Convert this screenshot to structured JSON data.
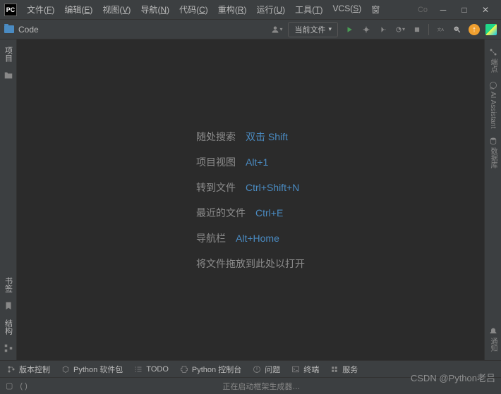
{
  "titlebar": {
    "logo": "PC",
    "menus": [
      {
        "label": "文件",
        "key": "F"
      },
      {
        "label": "编辑",
        "key": "E"
      },
      {
        "label": "视图",
        "key": "V"
      },
      {
        "label": "导航",
        "key": "N"
      },
      {
        "label": "代码",
        "key": "C"
      },
      {
        "label": "重构",
        "key": "R"
      },
      {
        "label": "运行",
        "key": "U"
      },
      {
        "label": "工具",
        "key": "T"
      },
      {
        "label": "VCS",
        "key": "S"
      }
    ],
    "search_hint": "Co"
  },
  "toolbar": {
    "project": "Code",
    "run_config": "当前文件"
  },
  "left_sidebar": {
    "top": "项目",
    "bottom1": "书签",
    "bottom2": "结构"
  },
  "right_sidebar": {
    "tab1": "端点",
    "tab2": "AI Assistant",
    "tab3": "数据库",
    "tab4": "通知"
  },
  "empty_state": {
    "rows": [
      {
        "label": "随处搜索",
        "key": "双击 Shift"
      },
      {
        "label": "项目视图",
        "key": "Alt+1"
      },
      {
        "label": "转到文件",
        "key": "Ctrl+Shift+N"
      },
      {
        "label": "最近的文件",
        "key": "Ctrl+E"
      },
      {
        "label": "导航栏",
        "key": "Alt+Home"
      }
    ],
    "drop_text": "将文件拖放到此处以打开"
  },
  "bottom_toolbar": {
    "items": [
      "版本控制",
      "Python 软件包",
      "TODO",
      "Python 控制台",
      "问题",
      "终端",
      "服务"
    ]
  },
  "statusbar": {
    "indicator": "( )",
    "message": "正在启动框架生成器…"
  },
  "watermark": "CSDN @Python老吕"
}
